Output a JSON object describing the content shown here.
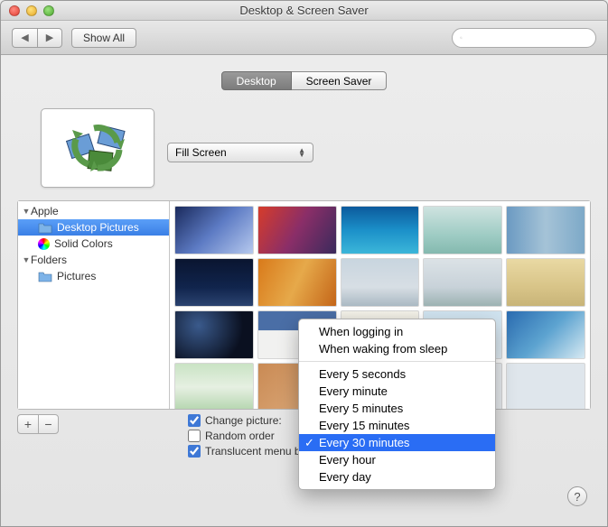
{
  "window": {
    "title": "Desktop & Screen Saver"
  },
  "toolbar": {
    "show_all": "Show All"
  },
  "tabs": {
    "desktop": "Desktop",
    "screensaver": "Screen Saver"
  },
  "fit": {
    "label": "Fill Screen"
  },
  "sidebar": {
    "groups": [
      {
        "label": "Apple",
        "items": [
          {
            "label": "Desktop Pictures"
          },
          {
            "label": "Solid Colors"
          }
        ]
      },
      {
        "label": "Folders",
        "items": [
          {
            "label": "Pictures"
          }
        ]
      }
    ]
  },
  "options": {
    "change_label": "Change picture:",
    "random_label": "Random order",
    "translucent_label": "Translucent menu bar"
  },
  "menu": {
    "items_a": [
      "When logging in",
      "When waking from sleep"
    ],
    "items_b": [
      "Every 5 seconds",
      "Every minute",
      "Every 5 minutes",
      "Every 15 minutes",
      "Every 30 minutes",
      "Every hour",
      "Every day"
    ],
    "selected": "Every 30 minutes"
  },
  "thumbs": [
    "linear-gradient(135deg,#1a2a5c,#5d7bc4 50%,#b6c9ee)",
    "linear-gradient(120deg,#d63c2a,#8a2e68,#3a2a5c)",
    "linear-gradient(#0c5a9c,#1b90c9,#3cb6d9)",
    "linear-gradient(#cfe3e0,#9fccc4 60%,#84b9af)",
    "linear-gradient(90deg,#6b9ac2,#a5c3d7,#7da9c8)",
    "linear-gradient(#0a1530,#10244c 60%,#2b4370)",
    "linear-gradient(115deg,#d97a1a,#e6a94a,#c46518)",
    "linear-gradient(#c8d5df,#d7dee4 60%,#aab9c3)",
    "linear-gradient(#dbe2e6,#c8d2d9 60%,#9cb2b2)",
    "linear-gradient(#e9d9a3,#d8c488 60%,#c8b478)",
    "radial-gradient(circle at 30% 30%,#3a5a8c,#0a1020 70%)",
    "linear-gradient(#4a6ea6 40%,#f1f1f0 41%)",
    "linear-gradient(#f4f2ea,#d8d3c0)",
    "linear-gradient(#cfe3f0,#e2edf4)",
    "linear-gradient(135deg,#2a6bb0,#5ca3d0 50%,#d7e9f2)",
    "linear-gradient(#c9e3c4,#e6f0e2 50%,#b4d6ae)",
    "linear-gradient(135deg,#c98a54,#e0b082)",
    "#eef1e8",
    "#e8ecf0",
    "#dfe6ec"
  ]
}
